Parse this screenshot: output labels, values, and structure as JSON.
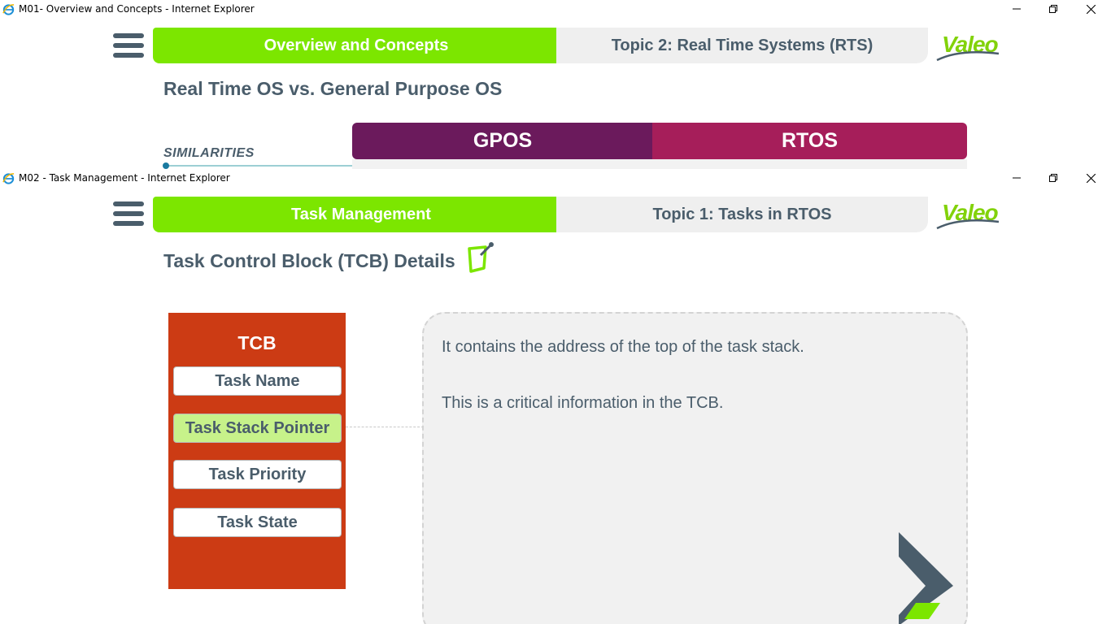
{
  "window1": {
    "title": "M01- Overview and Concepts - Internet Explorer",
    "module_tab": "Overview and Concepts",
    "topic_tab": "Topic 2: Real Time Systems (RTS)",
    "logo_text": "Valeo",
    "page_title": "Real Time OS vs. General Purpose OS",
    "section_label": "SIMILARITIES",
    "tabs": [
      "GPOS",
      "RTOS"
    ]
  },
  "window2": {
    "title": "M02 - Task Management - Internet Explorer",
    "module_tab": "Task Management",
    "topic_tab": "Topic 1: Tasks in RTOS",
    "logo_text": "Valeo",
    "page_title": "Task Control Block (TCB) Details",
    "tcb": {
      "heading": "TCB",
      "items": [
        {
          "label": "Task Name",
          "selected": false
        },
        {
          "label": "Task Stack Pointer",
          "selected": true
        },
        {
          "label": "Task Priority",
          "selected": false
        },
        {
          "label": "Task State",
          "selected": false
        }
      ]
    },
    "info": {
      "line1": "It contains the address of the top of the task stack.",
      "line2": "This is a critical information in the TCB."
    }
  },
  "colors": {
    "accent_green": "#7ce600",
    "text_slate": "#4a5d6b",
    "gpos_purple": "#6b1a5c",
    "rtos_magenta": "#a61e5a",
    "tcb_orange": "#cc3b14",
    "selected_green": "#c7f28a"
  },
  "icons": [
    "ie-icon",
    "minimize-icon",
    "restore-icon",
    "close-icon",
    "hamburger-menu-icon",
    "valeo-logo",
    "edit-note-icon",
    "next-arrow-icon"
  ]
}
